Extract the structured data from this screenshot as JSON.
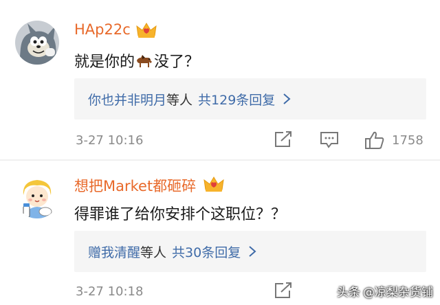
{
  "comments": [
    {
      "username": "HAp22c",
      "text_before": "就是你的",
      "text_after": "没了？",
      "reply_names": "你也并非明月",
      "reply_etc": "等人",
      "reply_count": "共129条回复",
      "time": "3-27 10:16",
      "likes": "1758"
    },
    {
      "username": "想把Market都砸碎",
      "text": "得罪谁了给你安排个这职位？？",
      "reply_names": "赠我清醒",
      "reply_etc": "等人",
      "reply_count": "共30条回复",
      "time": "3-27 10:18"
    }
  ],
  "watermark": {
    "source": "头条",
    "at": "@凉梨杂货铺"
  },
  "icons": {
    "avatar1": "cartoon-cat-avatar",
    "avatar2": "cartoon-child-avatar",
    "badge": "crown-vip-icon",
    "emoji": "horse-emoji",
    "share": "share-icon",
    "comment": "comment-icon",
    "like": "thumbs-up-icon"
  },
  "colors": {
    "username": "#e8692a",
    "link": "#3f6ba8",
    "meta": "#8a8a8a",
    "reply_bg": "#f5f5f5"
  }
}
